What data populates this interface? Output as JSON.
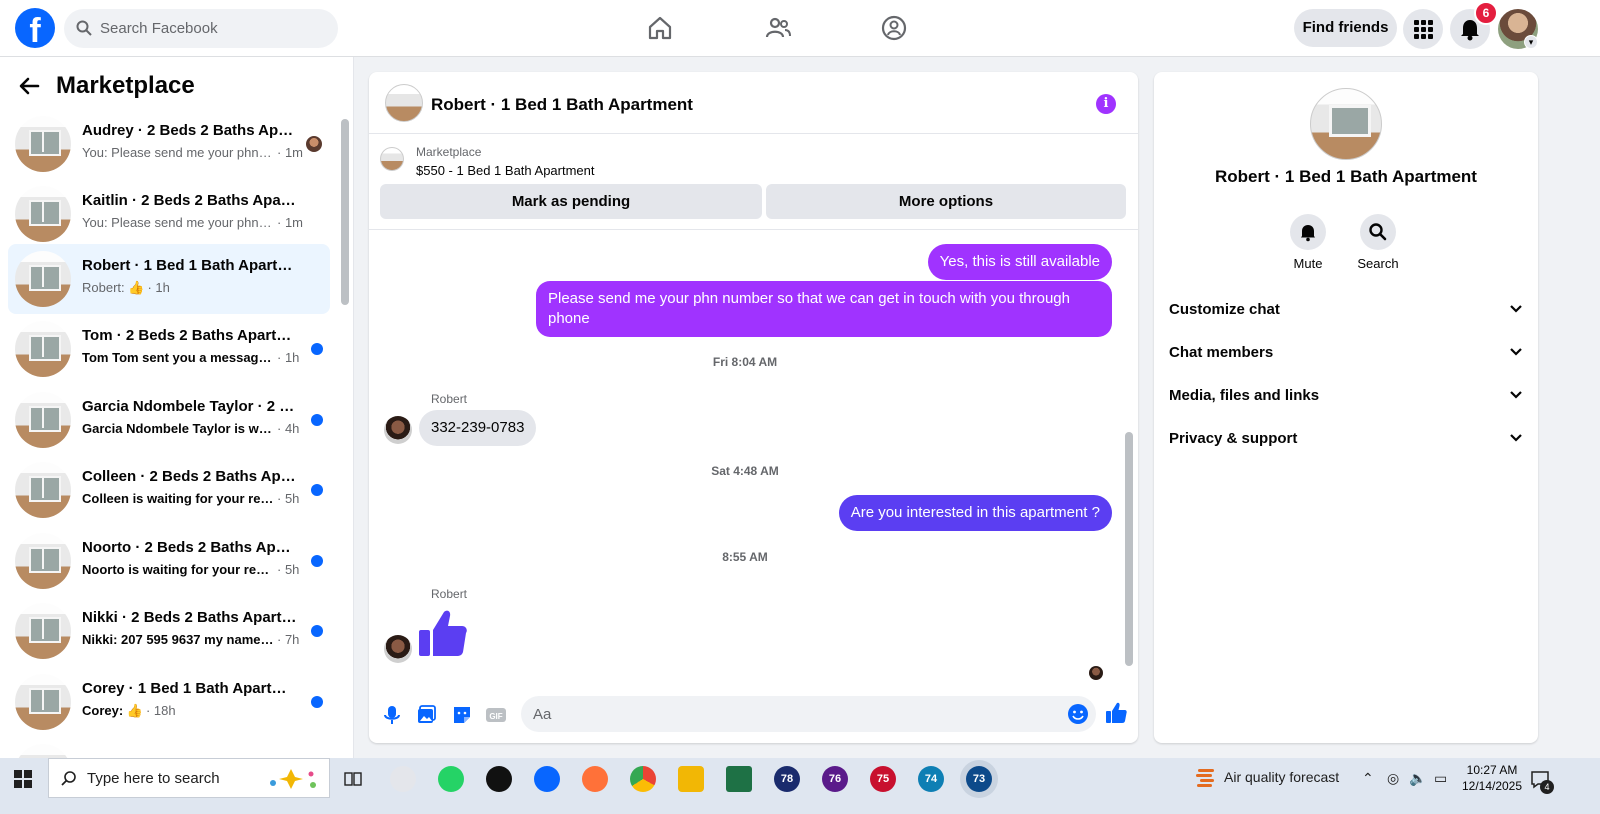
{
  "topbar": {
    "logo": "f",
    "search_placeholder": "Search Facebook",
    "find_friends": "Find friends",
    "notification_count": "6"
  },
  "left": {
    "title": "Marketplace",
    "conversations": [
      {
        "name": "Audrey · 2 Beds 2 Baths Apart...",
        "snippet": "You: Please send me your phn n...",
        "time": "· 1m",
        "unread": false
      },
      {
        "name": "Kaitlin · 2 Beds 2 Baths Apartment",
        "snippet": "You: Please send me your phn nu...",
        "time": "· 1m",
        "unread": false
      },
      {
        "name": "Robert · 1 Bed 1 Bath Apartment",
        "snippet": "Robert: 👍",
        "time": "· 1h",
        "unread": false
      },
      {
        "name": "Tom · 2 Beds 2 Baths Apartment",
        "snippet": "Tom Tom sent you a message a...",
        "time": "· 1h",
        "unread": true
      },
      {
        "name": "Garcia Ndombele Taylor · 2 Be...",
        "snippet": "Garcia Ndombele Taylor is waiti...",
        "time": "· 4h",
        "unread": true
      },
      {
        "name": "Colleen · 2 Beds 2 Baths Apart...",
        "snippet": "Colleen is waiting for your resp...",
        "time": "· 5h",
        "unread": true
      },
      {
        "name": "Noorto · 2 Beds 2 Baths Apart...",
        "snippet": "Noorto is waiting for your resp...",
        "time": "· 5h",
        "unread": true
      },
      {
        "name": "Nikki · 2 Beds 2 Baths Apartm...",
        "snippet": "Nikki: 207 595 9637 my name is...",
        "time": "· 7h",
        "unread": true
      },
      {
        "name": "Corey · 1 Bed 1 Bath Apartment",
        "snippet": "Corey: 👍",
        "time": "· 18h",
        "unread": true
      }
    ]
  },
  "chat": {
    "title": "Robert · 1 Bed 1 Bath Apartment",
    "marketplace_label": "Marketplace",
    "listing": "$550 - 1 Bed 1 Bath Apartment",
    "mark_pending": "Mark as pending",
    "more_options": "More options",
    "messages": {
      "out1": "Yes, this is still available",
      "out2": "Please send me your phn number so that we can get in touch with you through phone",
      "ts1": "Fri 8:04 AM",
      "sender1": "Robert",
      "in1": "332-239-0783",
      "ts2": "Sat 4:48 AM",
      "out3": "Are you interested in this apartment ?",
      "ts3": "8:55 AM",
      "sender2": "Robert"
    },
    "input_placeholder": "Aa"
  },
  "right": {
    "name": "Robert · 1 Bed 1 Bath Apartment",
    "mute": "Mute",
    "search": "Search",
    "sections": [
      "Customize chat",
      "Chat members",
      "Media, files and links",
      "Privacy & support"
    ]
  },
  "taskbar": {
    "search_placeholder": "Type here to search",
    "air_quality": "Air quality forecast",
    "time": "10:27 AM",
    "date": "12/14/2025",
    "notif_count": "4",
    "app_badges": [
      "78",
      "76",
      "75",
      "74",
      "73"
    ]
  },
  "colors": {
    "accent": "#0866ff",
    "purple_bubble": "#a033ff",
    "blue_bubble": "#5b3ef2"
  }
}
